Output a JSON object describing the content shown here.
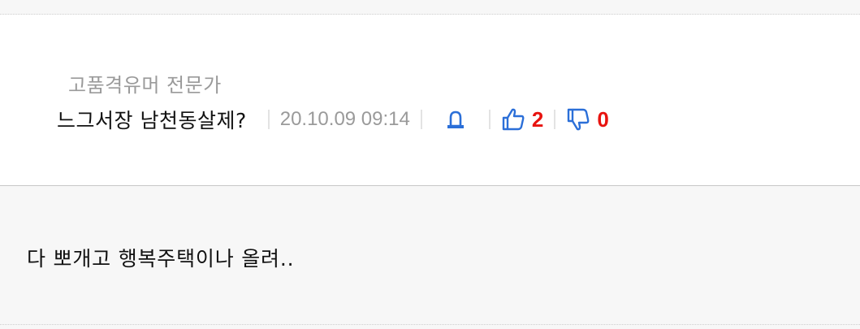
{
  "comment": {
    "author_title": "고품격유머 전문가",
    "nickname": "느그서장 남천동살제?",
    "datetime": "20.10.09 09:14",
    "report_icon": "siren-icon",
    "like_icon": "thumbs-up-icon",
    "like_count": "2",
    "dislike_icon": "thumbs-down-icon",
    "dislike_count": "0",
    "body": "다 뽀개고 행복주택이나 올려.."
  },
  "colors": {
    "accent_blue": "#2b6fd8",
    "count_red": "#e8130f",
    "meta_gray": "#9a9a9a"
  }
}
